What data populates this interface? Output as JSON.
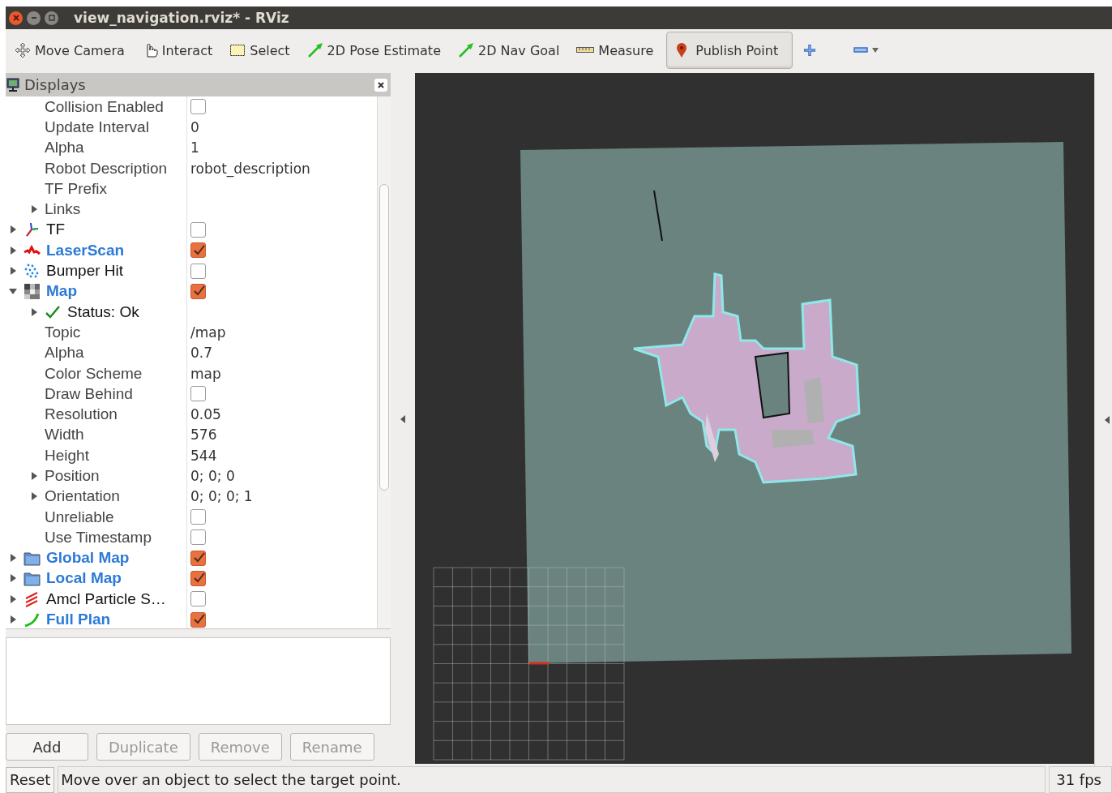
{
  "window": {
    "title": "view_navigation.rviz* - RViz"
  },
  "toolbar": {
    "tools": [
      {
        "kind": "move",
        "label": "Move Camera",
        "selected": false
      },
      {
        "kind": "interact",
        "label": "Interact",
        "selected": false
      },
      {
        "kind": "select",
        "label": "Select",
        "selected": false
      },
      {
        "kind": "pose",
        "label": "2D Pose Estimate",
        "selected": false
      },
      {
        "kind": "goal",
        "label": "2D Nav Goal",
        "selected": false
      },
      {
        "kind": "measure",
        "label": "Measure",
        "selected": false
      },
      {
        "kind": "point",
        "label": "Publish Point",
        "selected": true
      }
    ]
  },
  "displays": {
    "title": "Displays",
    "tree": [
      {
        "children": [
          {
            "kind": "property",
            "label": "Collision Enabled",
            "checked": false
          },
          {
            "kind": "property",
            "label": "Update Interval",
            "value": "0"
          },
          {
            "kind": "property",
            "label": "Alpha",
            "value": "1"
          },
          {
            "kind": "property",
            "label": "Robot Description",
            "value": "robot_description"
          },
          {
            "kind": "property",
            "label": "TF Prefix"
          },
          {
            "kind": "property",
            "label": "Links",
            "expanded": false
          }
        ]
      },
      {
        "kind": "tf",
        "label": "TF",
        "checked": false,
        "expanded": false
      },
      {
        "kind": "laser",
        "label": "LaserScan",
        "checked": true,
        "expanded": false
      },
      {
        "kind": "points",
        "label": "Bumper Hit",
        "checked": false,
        "expanded": false
      },
      {
        "kind": "map",
        "label": "Map",
        "checked": true,
        "expanded": true,
        "children": [
          {
            "kind": "status",
            "label": "Status: Ok",
            "expanded": false
          },
          {
            "kind": "property",
            "label": "Topic",
            "value": "/map"
          },
          {
            "kind": "property",
            "label": "Alpha",
            "value": "0.7"
          },
          {
            "kind": "property",
            "label": "Color Scheme",
            "value": "map"
          },
          {
            "kind": "property",
            "label": "Draw Behind",
            "checked": false
          },
          {
            "kind": "property",
            "label": "Resolution",
            "value": "0.05"
          },
          {
            "kind": "property",
            "label": "Width",
            "value": "576"
          },
          {
            "kind": "property",
            "label": "Height",
            "value": "544"
          },
          {
            "kind": "property",
            "label": "Position",
            "value": "0; 0; 0",
            "expanded": false
          },
          {
            "kind": "property",
            "label": "Orientation",
            "value": "0; 0; 0; 1",
            "expanded": false
          },
          {
            "kind": "property",
            "label": "Unreliable",
            "checked": false
          },
          {
            "kind": "property",
            "label": "Use Timestamp",
            "checked": false
          }
        ]
      },
      {
        "kind": "folder",
        "label": "Global Map",
        "checked": true,
        "expanded": false
      },
      {
        "kind": "folder",
        "label": "Local Map",
        "checked": true,
        "expanded": false
      },
      {
        "kind": "particles",
        "label": "Amcl Particle S…",
        "checked": false,
        "expanded": false
      },
      {
        "kind": "path",
        "label": "Full Plan",
        "checked": true,
        "expanded": false
      }
    ],
    "buttons": [
      {
        "label": "Add",
        "disabled": false
      },
      {
        "label": "Duplicate",
        "disabled": true
      },
      {
        "label": "Remove",
        "disabled": true
      },
      {
        "label": "Rename",
        "disabled": true
      }
    ]
  },
  "status_bar": {
    "reset": "Reset",
    "message": "Move over an object to select the target point.",
    "fps": "31 fps"
  }
}
